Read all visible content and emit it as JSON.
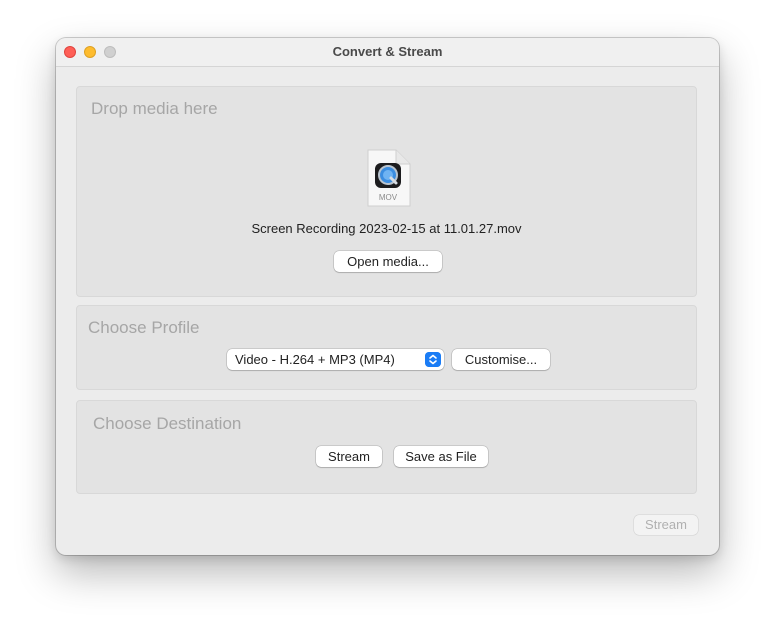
{
  "window": {
    "title": "Convert & Stream",
    "traffic_lights": {
      "close": "close-button",
      "minimize": "minimize-button",
      "zoom": "zoom-button"
    }
  },
  "media": {
    "section_label": "Drop media here",
    "file_icon": "mov-file-icon",
    "file_type": "MOV",
    "file_name": "Screen Recording 2023-02-15 at 11.01.27.mov",
    "open_button": "Open media..."
  },
  "profile": {
    "section_label": "Choose Profile",
    "selected": "Video - H.264 + MP3 (MP4)",
    "customise_button": "Customise..."
  },
  "destination": {
    "section_label": "Choose Destination",
    "stream_button": "Stream",
    "save_button": "Save as File"
  },
  "footer": {
    "stream_button": "Stream",
    "stream_enabled": false
  },
  "colors": {
    "accent": "#1a7cf5",
    "close": "#fe5f57",
    "minimize": "#febc2e"
  }
}
